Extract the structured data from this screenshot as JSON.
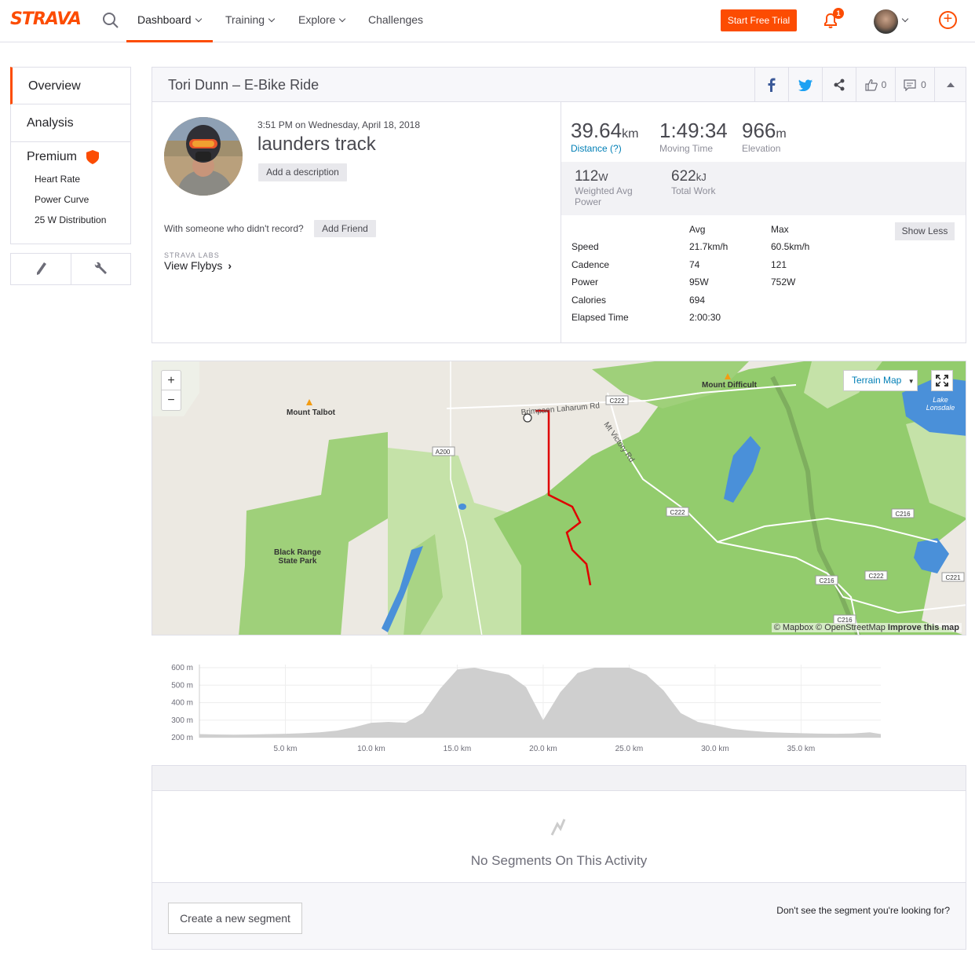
{
  "nav": {
    "logo": "STRAVA",
    "items": [
      "Dashboard",
      "Training",
      "Explore",
      "Challenges"
    ],
    "start_trial": "Start Free Trial",
    "notification_count": "1"
  },
  "sidebar": {
    "overview": "Overview",
    "analysis": "Analysis",
    "premium": "Premium",
    "premium_items": [
      "Heart Rate",
      "Power Curve",
      "25 W Distribution"
    ]
  },
  "activity": {
    "header_title": "Tori Dunn – E-Bike Ride",
    "kudos_count": "0",
    "comments_count": "0",
    "timestamp": "3:51 PM on Wednesday, April 18, 2018",
    "title": "launders track",
    "add_description": "Add a description",
    "with_someone": "With someone who didn't record?",
    "add_friend": "Add Friend",
    "labs": "STRAVA LABS",
    "view_flybys": "View Flybys"
  },
  "stats": {
    "distance": {
      "value": "39.64",
      "unit": "km",
      "label": "Distance (?)"
    },
    "moving_time": {
      "value": "1:49:34",
      "label": "Moving Time"
    },
    "elevation": {
      "value": "966",
      "unit": "m",
      "label": "Elevation"
    },
    "weighted_power": {
      "value": "112",
      "unit": "W",
      "label": "Weighted Avg Power"
    },
    "total_work": {
      "value": "622",
      "unit": "kJ",
      "label": "Total Work"
    },
    "show_less": "Show Less",
    "columns": [
      "Avg",
      "Max"
    ],
    "rows": [
      {
        "label": "Speed",
        "avg": "21.7km/h",
        "max": "60.5km/h"
      },
      {
        "label": "Cadence",
        "avg": "74",
        "max": "121"
      },
      {
        "label": "Power",
        "avg": "95W",
        "max": "752W"
      },
      {
        "label": "Calories",
        "avg": "694",
        "max": ""
      },
      {
        "label": "Elapsed Time",
        "avg": "2:00:30",
        "max": ""
      }
    ]
  },
  "map": {
    "terrain_button": "Terrain Map",
    "zoom_in": "+",
    "zoom_out": "−",
    "attribution": "© Mapbox © OpenStreetMap",
    "improve": "Improve this map",
    "labels": {
      "mount_talbot": "Mount Talbot",
      "mount_difficult": "Mount Difficult",
      "brimpaen": "Brimpaen Laharum Rd",
      "mt_victory": "Mt Victory Rd",
      "black_range_1": "Black Range",
      "black_range_2": "State Park",
      "lake_1": "Lake",
      "lake_2": "Lonsdale",
      "a200": "A200",
      "c222a": "C222",
      "c222b": "C222",
      "c222c": "C222",
      "c216a": "C216",
      "c216b": "C216",
      "c216c": "C216",
      "c221": "C221"
    }
  },
  "chart_data": {
    "type": "area",
    "title": "",
    "xlabel": "",
    "ylabel": "",
    "y_ticks": [
      "600 m",
      "500 m",
      "400 m",
      "300 m",
      "200 m"
    ],
    "x_ticks": [
      "5.0 km",
      "10.0 km",
      "15.0 km",
      "20.0 km",
      "25.0 km",
      "30.0 km",
      "35.0 km"
    ],
    "xlim": [
      0,
      39.64
    ],
    "ylim": [
      200,
      600
    ],
    "x": [
      0,
      1,
      2,
      3,
      4,
      5,
      6,
      7,
      8,
      9,
      10,
      11,
      12,
      13,
      14,
      15,
      16,
      17,
      18,
      19,
      20,
      21,
      22,
      23,
      24,
      25,
      26,
      27,
      28,
      29,
      30,
      31,
      32,
      33,
      34,
      35,
      36,
      37,
      38,
      39,
      39.64
    ],
    "y": [
      220,
      218,
      217,
      218,
      220,
      222,
      225,
      230,
      240,
      260,
      285,
      290,
      285,
      340,
      480,
      590,
      600,
      580,
      560,
      490,
      300,
      460,
      570,
      600,
      600,
      600,
      560,
      470,
      340,
      290,
      270,
      250,
      240,
      232,
      228,
      225,
      223,
      222,
      224,
      230,
      220
    ]
  },
  "segments": {
    "no_segments": "No Segments On This Activity",
    "create": "Create a new segment",
    "dont_see": "Don't see the segment you're looking for?"
  }
}
